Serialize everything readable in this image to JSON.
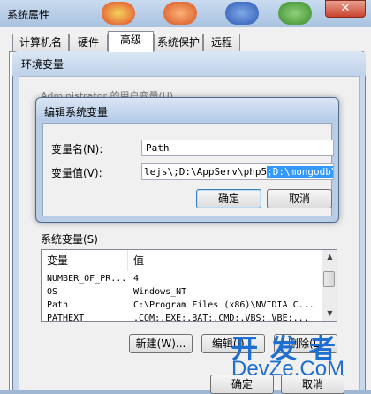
{
  "outer_window": {
    "title": "系统属性",
    "close_glyph": "✕"
  },
  "tabs": [
    {
      "label": "计算机名"
    },
    {
      "label": "硬件"
    },
    {
      "label": "高级"
    },
    {
      "label": "系统保护"
    },
    {
      "label": "远程"
    }
  ],
  "env_window": {
    "title": "环境变量",
    "user_vars_label_faded": "Administrator 的用户变量(U)"
  },
  "edit_dialog": {
    "title": "编辑系统变量",
    "name_label": "变量名(N):",
    "name_value": "Path",
    "value_label": "变量值(V):",
    "value_before": "lejs\\;D:\\AppServ\\php5",
    "value_selected": ";D:\\mongodb\\bin",
    "ok_label": "确定",
    "cancel_label": "取消"
  },
  "system_vars": {
    "group_label": "系统变量(S)",
    "columns": [
      "变量",
      "值"
    ],
    "rows": [
      {
        "name": "NUMBER_OF_PR...",
        "value": "4"
      },
      {
        "name": "OS",
        "value": "Windows_NT"
      },
      {
        "name": "Path",
        "value": "C:\\Program Files (x86)\\NVIDIA C..."
      },
      {
        "name": "PATHEXT",
        "value": ".COM;.EXE;.BAT;.CMD;.VBS;.VBE;..."
      }
    ],
    "new_label": "新建(W)...",
    "edit_label": "编辑(I)...",
    "delete_label": "删除(L)"
  },
  "bottom_buttons": {
    "ok_label": "确定",
    "cancel_label": "取消"
  },
  "watermark": {
    "cn": "开发者",
    "en": "DevZe.CoM"
  },
  "colors": {
    "selection": "#3399ff",
    "watermark": "#1e6fd0"
  }
}
